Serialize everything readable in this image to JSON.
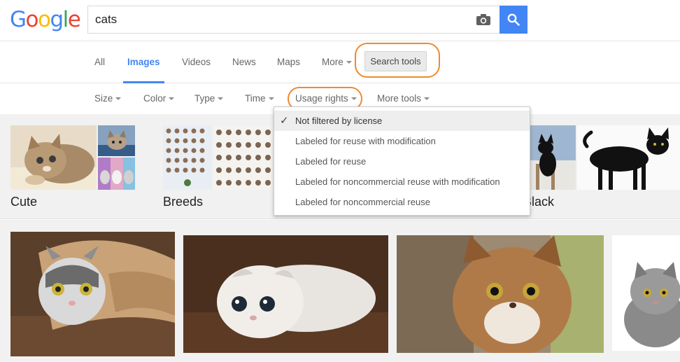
{
  "logo": {
    "letters": [
      "G",
      "o",
      "o",
      "g",
      "l",
      "e"
    ],
    "colors": [
      "#4285f4",
      "#ea4335",
      "#fbbc05",
      "#4285f4",
      "#34a853",
      "#ea4335"
    ]
  },
  "search": {
    "value": "cats",
    "camera_icon": "camera-icon",
    "button_icon": "search-icon"
  },
  "nav": {
    "tabs": [
      {
        "label": "All"
      },
      {
        "label": "Images",
        "active": true
      },
      {
        "label": "Videos"
      },
      {
        "label": "News"
      },
      {
        "label": "Maps"
      },
      {
        "label": "More"
      }
    ],
    "search_tools_label": "Search tools"
  },
  "tools": {
    "items": [
      {
        "label": "Size"
      },
      {
        "label": "Color"
      },
      {
        "label": "Type"
      },
      {
        "label": "Time"
      },
      {
        "label": "Usage rights"
      },
      {
        "label": "More tools"
      }
    ]
  },
  "usage_menu": {
    "items": [
      {
        "label": "Not filtered by license",
        "selected": true
      },
      {
        "label": "Labeled for reuse with modification"
      },
      {
        "label": "Labeled for reuse"
      },
      {
        "label": "Labeled for noncommercial reuse with modification"
      },
      {
        "label": "Labeled for noncommercial reuse"
      }
    ]
  },
  "related": {
    "categories": [
      {
        "label": "Cute"
      },
      {
        "label": "Breeds"
      },
      {
        "label": "Black"
      }
    ]
  },
  "colors": {
    "accent": "#4285f4",
    "highlight": "#ee8a2d"
  }
}
